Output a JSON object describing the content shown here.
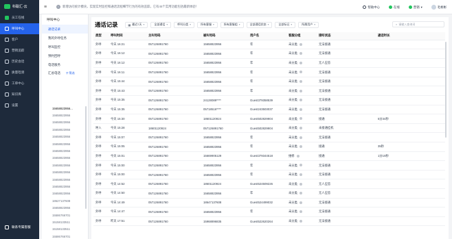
{
  "sidebar": {
    "brand": "科聪汇-云",
    "items": [
      {
        "label": "员工在线",
        "icon": "status-dot-icon"
      },
      {
        "label": "呼叫中心",
        "icon": "phone-icon",
        "active": true
      },
      {
        "label": "客户",
        "icon": "user-icon"
      },
      {
        "label": "营销追踪",
        "icon": "chart-icon"
      },
      {
        "label": "历史会话",
        "icon": "chat-icon"
      },
      {
        "label": "质量检测",
        "icon": "check-icon"
      },
      {
        "label": "工单中心",
        "icon": "ticket-icon"
      },
      {
        "label": "知识库",
        "icon": "book-icon"
      },
      {
        "label": "设置",
        "icon": "gear-icon"
      }
    ],
    "footer": "联系专属客服"
  },
  "topbar": {
    "notice": "新增访问统计模块，实现实时监控和通话流程细节行为的有效追踪，它有45个实用功能包括最新体验！",
    "help": "帮助中心",
    "status": "在线",
    "group": "营销",
    "user": "毛彬彬"
  },
  "panel": {
    "title": "呼叫中心",
    "items": [
      "通话记录",
      "我的外呼任务",
      "呼叫监控",
      "预约回呼",
      "电话服务"
    ],
    "sub_label": "汇总电话",
    "sub_filter": "筛选",
    "numbers": [
      "15658823956...",
      "15658823956",
      "15658823956",
      "15658823956",
      "15658823956",
      "15658823956",
      "15658823956",
      "15658823956",
      "15658823956",
      "15658823956",
      "15658823956",
      "15658823956",
      "15658823956",
      "18627137608",
      "15658823956",
      "15586766701",
      "15158133511",
      "15158133511",
      "15586766701"
    ]
  },
  "main": {
    "title": "通话记录",
    "filters": [
      "最近7天",
      "全部通话",
      "呼叫分类",
      "所有客服",
      "所有客服组",
      "全部通话状态",
      "全部标记",
      "所属用户"
    ],
    "search_placeholder": "请输入查询词",
    "columns": [
      "类型",
      "呼叫时间",
      "主叫号码",
      "被叫号码",
      "用户名",
      "客服分组",
      "接听状态",
      "通话时长"
    ],
    "rows": [
      [
        "外呼",
        "今天 16:21",
        "057126891760",
        "15658823956",
        "年",
        "未分类",
        "无法接通",
        ""
      ],
      [
        "外呼",
        "今天 16:12",
        "057126891760",
        "15658823956",
        "年",
        "未分类",
        "无法接通",
        ""
      ],
      [
        "外呼",
        "今天 16:12",
        "057126891760",
        "15658823956",
        "年",
        "未分类",
        "无人应答",
        ""
      ],
      [
        "外呼",
        "今天 16:11",
        "057126891760",
        "15658823956",
        "年",
        "未分类",
        "无法接通",
        ""
      ],
      [
        "外呼",
        "今天 15:44",
        "057126891760",
        "15658823956",
        "年",
        "未分类",
        "无法接通",
        ""
      ],
      [
        "外呼",
        "今天 15:43",
        "057126891760",
        "15658823956",
        "年",
        "未分类",
        "无法接通",
        ""
      ],
      [
        "外呼",
        "今天 15:35",
        "057126891760",
        "24128089****",
        "Guest379358539",
        "未分类",
        "无法接通",
        ""
      ],
      [
        "外呼",
        "今天 15:35",
        "057126891760",
        "05718516****",
        "Guest243503037",
        "未分类",
        "无法接通",
        ""
      ],
      [
        "外呼",
        "今天 15:30",
        "057126891760",
        "18601120924",
        "Guest502829904",
        "未分类",
        "接通",
        "5分34秒"
      ],
      [
        "呼入",
        "今天 15:28",
        "18601120924",
        "057126891760",
        "Guest502829904",
        "未分类",
        "未接通挂机",
        ""
      ],
      [
        "外呼",
        "今天 15:07",
        "057126891760",
        "15658823956",
        "年",
        "未分类",
        "无法接通",
        ""
      ],
      [
        "外呼",
        "今天 15:05",
        "057126891760",
        "15658823956",
        "年",
        "未分类",
        "接通",
        "35秒"
      ],
      [
        "外呼",
        "今天 15:01",
        "057126891760",
        "15669905129",
        "Guest379344518",
        "维修",
        "接通",
        "1分19秒"
      ],
      [
        "外呼",
        "今天 15:00",
        "057126891760",
        "15658823956",
        "年",
        "未分类",
        "无法接通",
        ""
      ],
      [
        "外呼",
        "今天 15:00",
        "057126891760",
        "15658823956",
        "年",
        "未分类",
        "无法接通",
        ""
      ],
      [
        "外呼",
        "今天 14:52",
        "057126891760",
        "18601120924",
        "Guest524509226",
        "未分类",
        "无人应答",
        ""
      ],
      [
        "外呼",
        "今天 14:50",
        "057126891760",
        "15658823956",
        "年",
        "未分类",
        "无人应答",
        ""
      ],
      [
        "外呼",
        "今天 14:49",
        "057126891760",
        "18647137608",
        "Guest524499032",
        "未分类",
        "无法接通",
        ""
      ],
      [
        "外呼",
        "今天 14:47",
        "057126891760",
        "15658823956",
        "年",
        "未分类",
        "无法接通",
        ""
      ],
      [
        "外呼",
        "昨天 17:51",
        "057126891760",
        "15968896835",
        "Guest522620264",
        "未分类",
        "无法接通",
        ""
      ]
    ]
  },
  "colors": {
    "sidebar": "#1e2a3b",
    "accent": "#2563eb",
    "online": "#22c55e"
  }
}
